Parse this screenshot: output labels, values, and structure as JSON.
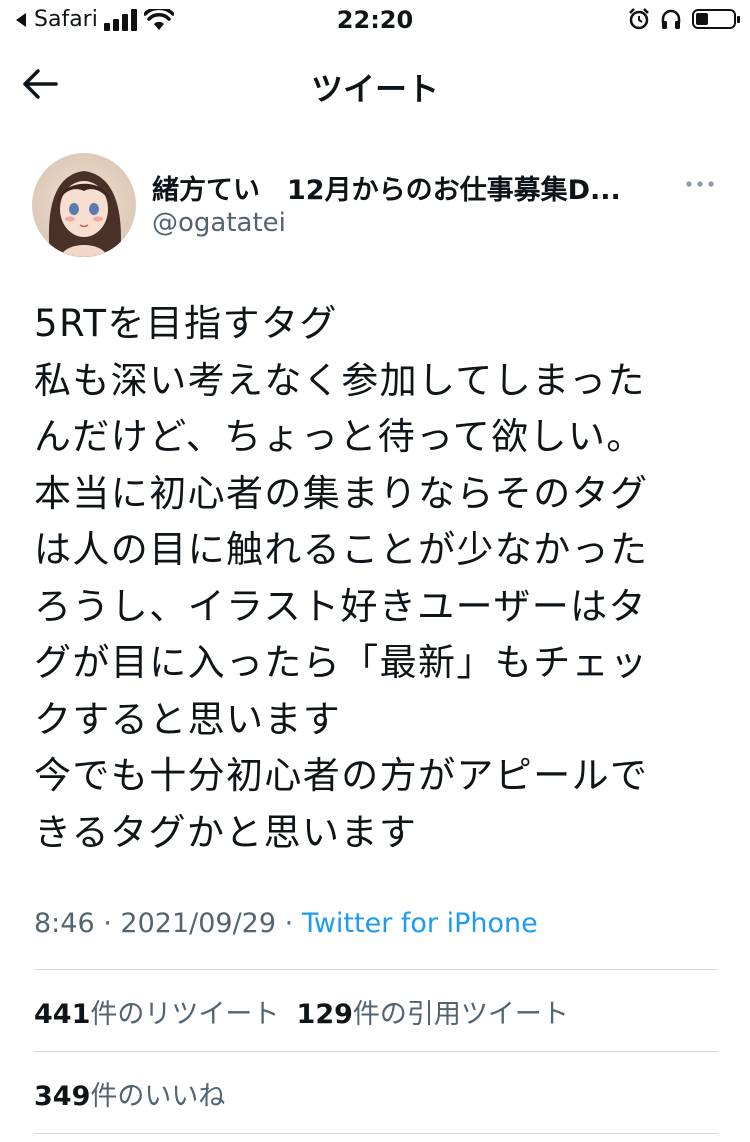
{
  "status_bar": {
    "back_app": "Safari",
    "time": "22:20"
  },
  "header": {
    "title": "ツイート"
  },
  "author": {
    "name": "緒方てい　12月からのお仕事募集D...",
    "handle": "@ogatatei"
  },
  "tweet": {
    "lines": [
      "5RTを目指すタグ",
      "私も深い考えなく参加してしまった",
      "んだけど、ちょっと待って欲しい。",
      "本当に初心者の集まりならそのタグ",
      "は人の目に触れることが少なかった",
      "ろうし、イラスト好きユーザーはタ",
      "グが目に入ったら「最新」もチェッ",
      "クすると思います",
      "今でも十分初心者の方がアピールで",
      "きるタグかと思います"
    ],
    "time": "8:46",
    "date": "2021/09/29",
    "separator": "·",
    "source": "Twitter for iPhone"
  },
  "stats": {
    "retweets_count": "441",
    "retweets_label": "件のリツイート",
    "quotes_count": "129",
    "quotes_label": "件の引用ツイート",
    "likes_count": "349",
    "likes_label": "件のいいね"
  },
  "colors": {
    "accent": "#1d9bf0",
    "secondary_text": "#536471",
    "primary_text": "#0f1419",
    "divider": "#cfd9de"
  },
  "icons": [
    "back-arrow-icon",
    "signal-bars-icon",
    "wifi-icon",
    "alarm-icon",
    "headphones-icon",
    "battery-icon",
    "more-icon"
  ]
}
